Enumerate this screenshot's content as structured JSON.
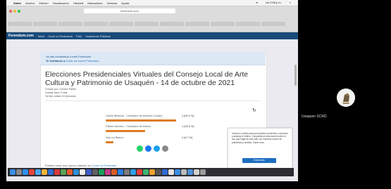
{
  "menubar": {
    "app": "Safari",
    "items": [
      "Archivo",
      "Edición",
      "Visualización",
      "Historial",
      "Marcadores",
      "Ventana",
      "Ayuda"
    ],
    "clock": "vie 2:58 p.m."
  },
  "browser": {
    "url": "ferendum.com"
  },
  "site": {
    "brand": "Ferendum.com",
    "nav": [
      "Inicio",
      "Crear un Ferendum",
      "FAQ",
      "Votaciones Públicas"
    ]
  },
  "notice": {
    "line1": "Ya has contestado a este Ferendum",
    "line2_bold": "Te invitamos a",
    "line2_link": "Crear un nuevo Ferendum"
  },
  "poll": {
    "title": "Elecciones Presidenciales Virtuales del Consejo Local de Arte Cultura y Patrimonio de Usaquén - 14 de octubre de 2021",
    "meta": [
      "Creado por: Carmen Patiño",
      "Creada hace 3 días",
      "Ya han votado 15 personas"
    ],
    "options": [
      {
        "label": "Carlos Miranda - Consejero de Asuntos Locales",
        "pct": "1 (60.0 %)",
        "fraction": 0.6
      },
      {
        "label": "Fabián Acevizo - Consejero de Danza",
        "pct": "1 (33.3 %)",
        "fraction": 0.333
      },
      {
        "label": "Voto en Blanco",
        "pct": "1 (6.7 %)",
        "fraction": 0.067
      }
    ],
    "create_prefix": "Puedes crear una nueva votación en",
    "create_link": "Crear un Ferendum"
  },
  "cookie": {
    "text": "Usamos cookies para personalizar contenido y anuncios y analizar el tráfico. Compartimos información sobre el uso que haga de este sitio con nuestros socios de publicidad y análisis. Saber más",
    "button": "Entendido"
  },
  "participant": {
    "name": "Usaquen SCRD"
  },
  "colors": {
    "nav": "#184a7a",
    "bar": "#e07b22",
    "link": "#1f6fc0"
  }
}
